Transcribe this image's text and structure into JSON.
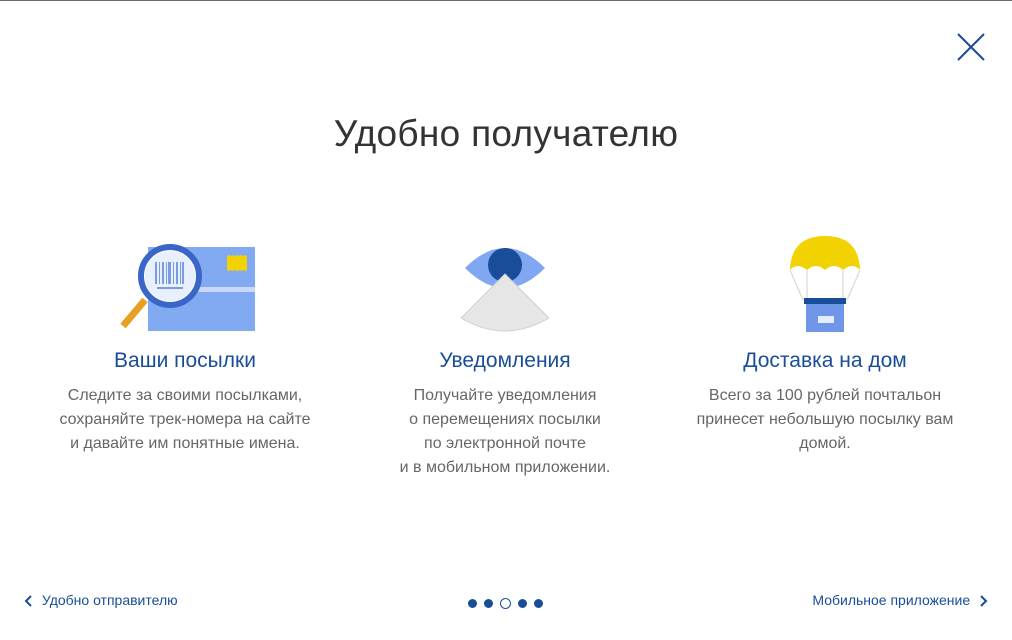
{
  "page": {
    "title": "Удобно получателю"
  },
  "features": [
    {
      "title": "Ваши посылки",
      "description": [
        "Следите за своими посылками,",
        "сохраняйте трек-номера на сайте",
        "и давайте им понятные имена."
      ],
      "icon": "parcel-search-icon"
    },
    {
      "title": "Уведомления",
      "description": [
        "Получайте уведомления",
        "о перемещениях посылки",
        "по электронной почте",
        "и в мобильном приложении."
      ],
      "icon": "eye-icon"
    },
    {
      "title": "Доставка на дом",
      "description": [
        "Всего за 100 рублей почтальон",
        "принесет небольшую посылку вам",
        "домой."
      ],
      "icon": "parachute-box-icon"
    }
  ],
  "navigation": {
    "prev_label": "Удобно отправителю",
    "next_label": "Мобильное приложение",
    "pager": {
      "total": 5,
      "active_index": 2
    }
  },
  "colors": {
    "accent": "#1a4d99",
    "title_text": "#333333",
    "body_text": "#666666",
    "card_blue": "#7fa7f2",
    "yellow": "#f2d200",
    "orange": "#e8a020"
  },
  "close": {
    "icon": "close-icon"
  }
}
